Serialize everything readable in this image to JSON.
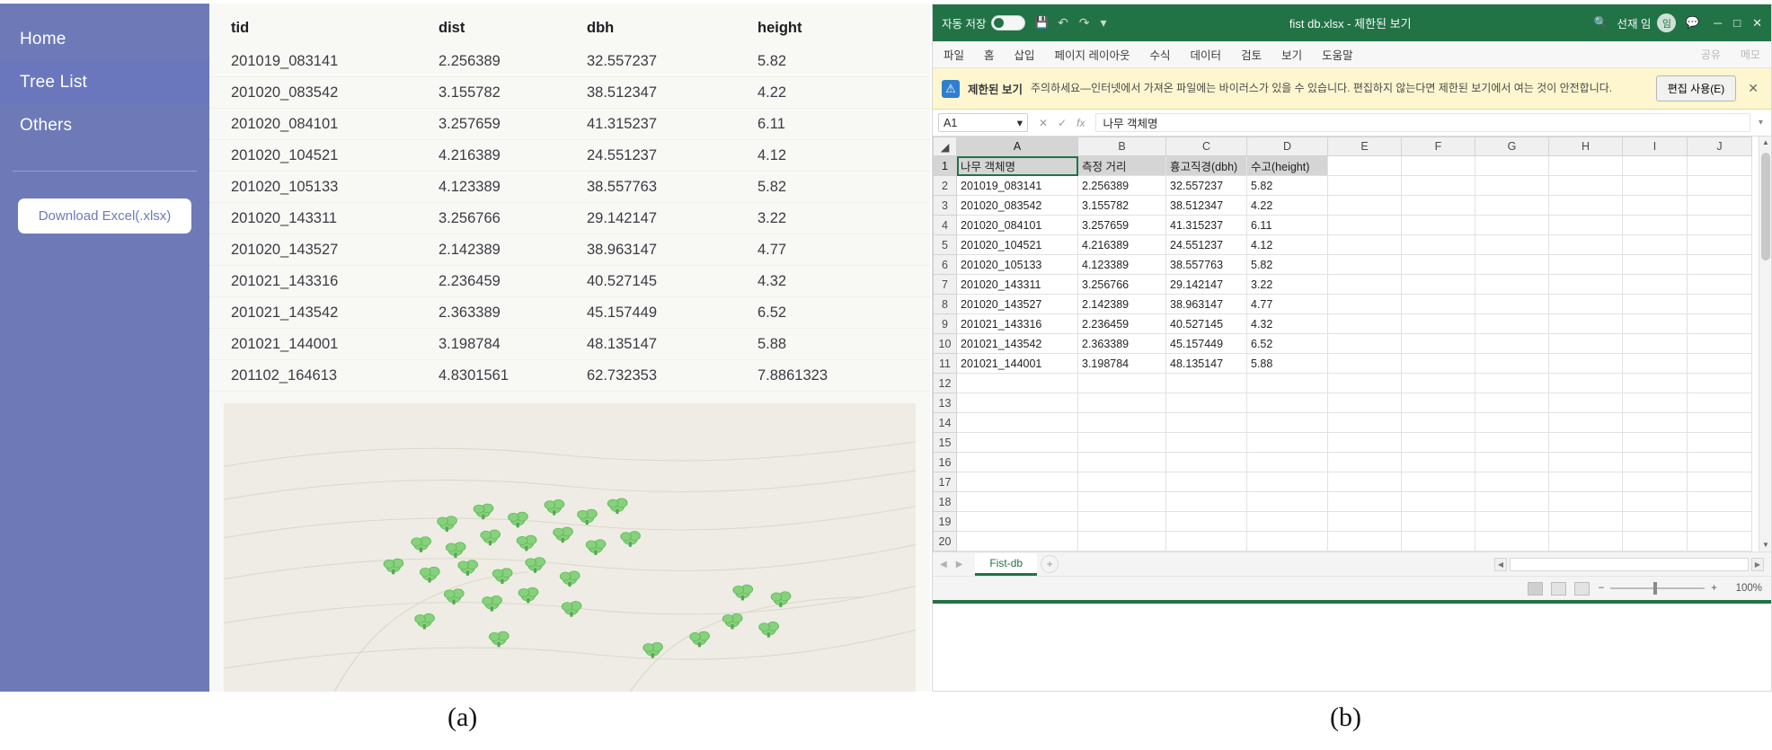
{
  "figure": {
    "caption_a": "(a)",
    "caption_b": "(b)"
  },
  "app": {
    "sidebar": {
      "items": [
        {
          "label": "Home",
          "active": false
        },
        {
          "label": "Tree List",
          "active": true
        },
        {
          "label": "Others",
          "active": false
        }
      ],
      "download_button": "Download Excel(.xlsx)"
    },
    "table": {
      "columns": [
        "tid",
        "dist",
        "dbh",
        "height"
      ],
      "rows": [
        [
          "201019_083141",
          "2.256389",
          "32.557237",
          "5.82"
        ],
        [
          "201020_083542",
          "3.155782",
          "38.512347",
          "4.22"
        ],
        [
          "201020_084101",
          "3.257659",
          "41.315237",
          "6.11"
        ],
        [
          "201020_104521",
          "4.216389",
          "24.551237",
          "4.12"
        ],
        [
          "201020_105133",
          "4.123389",
          "38.557763",
          "5.82"
        ],
        [
          "201020_143311",
          "3.256766",
          "29.142147",
          "3.22"
        ],
        [
          "201020_143527",
          "2.142389",
          "38.963147",
          "4.77"
        ],
        [
          "201021_143316",
          "2.236459",
          "40.527145",
          "4.32"
        ],
        [
          "201021_143542",
          "2.363389",
          "45.157449",
          "6.52"
        ],
        [
          "201021_144001",
          "3.198784",
          "48.135147",
          "5.88"
        ],
        [
          "201102_164613",
          "4.8301561",
          "62.732353",
          "7.8861323"
        ]
      ]
    },
    "scene": {
      "name": "tree-point-cloud-map",
      "background_color": "#eeece5",
      "contour_color": "#ddd9cc",
      "tree_color": "#84d07a"
    },
    "colors": {
      "sidebar": "#6e7ab8",
      "sidebar_active": "#6a77bd",
      "content": "#f8f8f5"
    }
  },
  "excel": {
    "titlebar": {
      "autosave_label": "자동 저장",
      "autosave_state": "off",
      "save_icon": "save-icon",
      "undo_icon": "undo-icon",
      "redo_icon": "redo-icon",
      "customize_icon": "chevron-down-icon",
      "document_title": "fist db.xlsx - 제한된 보기",
      "title_dropdown": "chevron-down-icon",
      "search_icon": "search-icon",
      "account_label": "선재 임",
      "avatar_initial": "임",
      "comments_icon": "comments-icon",
      "minimize": "─",
      "maximize": "□",
      "close": "✕"
    },
    "ribbon": {
      "tabs": [
        "파일",
        "홈",
        "삽입",
        "페이지 레이아웃",
        "수식",
        "데이터",
        "검토",
        "보기",
        "도움말"
      ],
      "share_label": "공유",
      "comment_label": "메모"
    },
    "protected_banner": {
      "icon": "shield-icon",
      "label": "제한된 보기",
      "message": "주의하세요—인터넷에서 가져온 파일에는 바이러스가 있을 수 있습니다. 편집하지 않는다면 제한된 보기에서 여는 것이 안전합니다.",
      "action_button": "편집 사용(E)",
      "close": "✕"
    },
    "formula_bar": {
      "namebox_value": "A1",
      "namebox_caret": "▾",
      "cancel_icon": "cancel-icon",
      "confirm_icon": "confirm-icon",
      "function_icon": "fx-icon",
      "formula_value": "나무 객체명",
      "expand_caret": "▾"
    },
    "grid": {
      "column_headers": [
        "A",
        "B",
        "C",
        "D",
        "E",
        "F",
        "G",
        "H",
        "I",
        "J"
      ],
      "selected_column": "A",
      "selected_row": "1",
      "active_cell": "A1",
      "row_numbers": [
        "1",
        "2",
        "3",
        "4",
        "5",
        "6",
        "7",
        "8",
        "9",
        "10",
        "11",
        "12",
        "13",
        "14",
        "15",
        "16",
        "17",
        "18",
        "19",
        "20"
      ],
      "header_row": [
        "나무 객체명",
        "측정 거리",
        "흉고직경(dbh)",
        "수고(height)"
      ],
      "data_rows": [
        [
          "201019_083141",
          "2.256389",
          "32.557237",
          "5.82"
        ],
        [
          "201020_083542",
          "3.155782",
          "38.512347",
          "4.22"
        ],
        [
          "201020_084101",
          "3.257659",
          "41.315237",
          "6.11"
        ],
        [
          "201020_104521",
          "4.216389",
          "24.551237",
          "4.12"
        ],
        [
          "201020_105133",
          "4.123389",
          "38.557763",
          "5.82"
        ],
        [
          "201020_143311",
          "3.256766",
          "29.142147",
          "3.22"
        ],
        [
          "201020_143527",
          "2.142389",
          "38.963147",
          "4.77"
        ],
        [
          "201021_143316",
          "2.236459",
          "40.527145",
          "4.32"
        ],
        [
          "201021_143542",
          "2.363389",
          "45.157449",
          "6.52"
        ],
        [
          "201021_144001",
          "3.198784",
          "48.135147",
          "5.88"
        ]
      ]
    },
    "sheet_tabs": {
      "prev_icon": "◀",
      "next_icon": "▶",
      "active_sheet": "Fist-db",
      "add_sheet": "+"
    },
    "status_bar": {
      "normal_view_icon": "normal-view-icon",
      "page_layout_icon": "page-layout-icon",
      "page_break_icon": "page-break-icon",
      "zoom_out": "−",
      "zoom_in": "+",
      "zoom_level": "100%"
    },
    "colors": {
      "chrome_green": "#217346",
      "banner_yellow": "#fdf6cf"
    }
  }
}
